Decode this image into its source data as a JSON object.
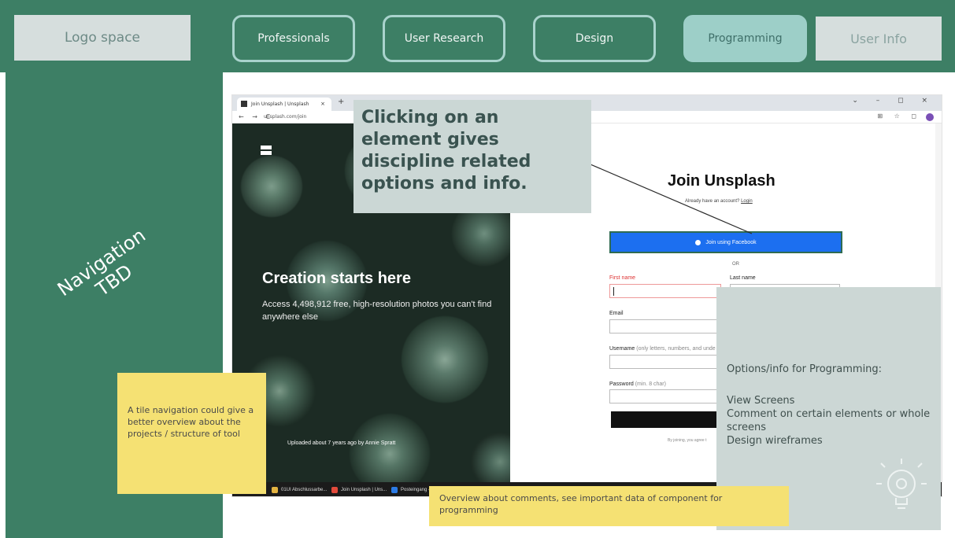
{
  "topbar": {
    "logo": "Logo space",
    "tabs": [
      {
        "label": "Professionals"
      },
      {
        "label": "User Research"
      },
      {
        "label": "Design"
      },
      {
        "label": "Programming"
      }
    ],
    "user_info": "User Info"
  },
  "sidenav": {
    "line1": "Navigation",
    "line2": "TBD"
  },
  "browser": {
    "tab_title": "Join Unsplash | Unsplash",
    "tab_close": "×",
    "new_tab": "+",
    "window_controls": "⌄ – ◻ ×",
    "nav_buttons": "← → C",
    "url": "unsplash.com/join",
    "extensions": "⊞ ☆ ◻"
  },
  "hero": {
    "title": "Creation starts here",
    "subtitle": "Access 4,498,912 free, high-resolution photos you can't find anywhere else",
    "credit": "Uploaded about 7 years ago by Annie Spratt"
  },
  "form": {
    "title": "Join Unsplash",
    "have_account": "Already have an account?",
    "login_link": "Login",
    "facebook_button": "Join using Facebook",
    "or": "OR",
    "first_name": "First name",
    "last_name": "Last name",
    "email": "Email",
    "username": "Username",
    "username_hint": "(only letters, numbers, and unde",
    "password": "Password",
    "password_hint": "(min. 8 char)",
    "terms": "By joining, you agree t"
  },
  "taskbar": {
    "items": [
      {
        "label": "01UI Abschlussarbe...",
        "color": "#e3b341"
      },
      {
        "label": "Join Unsplash | Uns...",
        "color": "#e24a3b"
      },
      {
        "label": "Posteingang - ...",
        "color": "#2c7be5"
      }
    ]
  },
  "callout": {
    "text": "Clicking on an element gives discipline related options and info."
  },
  "options_panel": {
    "title": "Options/info for Programming:",
    "items": [
      "View Screens",
      "Comment on certain elements or whole screens",
      "Design wireframes"
    ]
  },
  "notes": {
    "tile": "A tile navigation could give a better overview about the projects / structure of tool",
    "overview": "Overview about comments, see important data of component for programming"
  }
}
